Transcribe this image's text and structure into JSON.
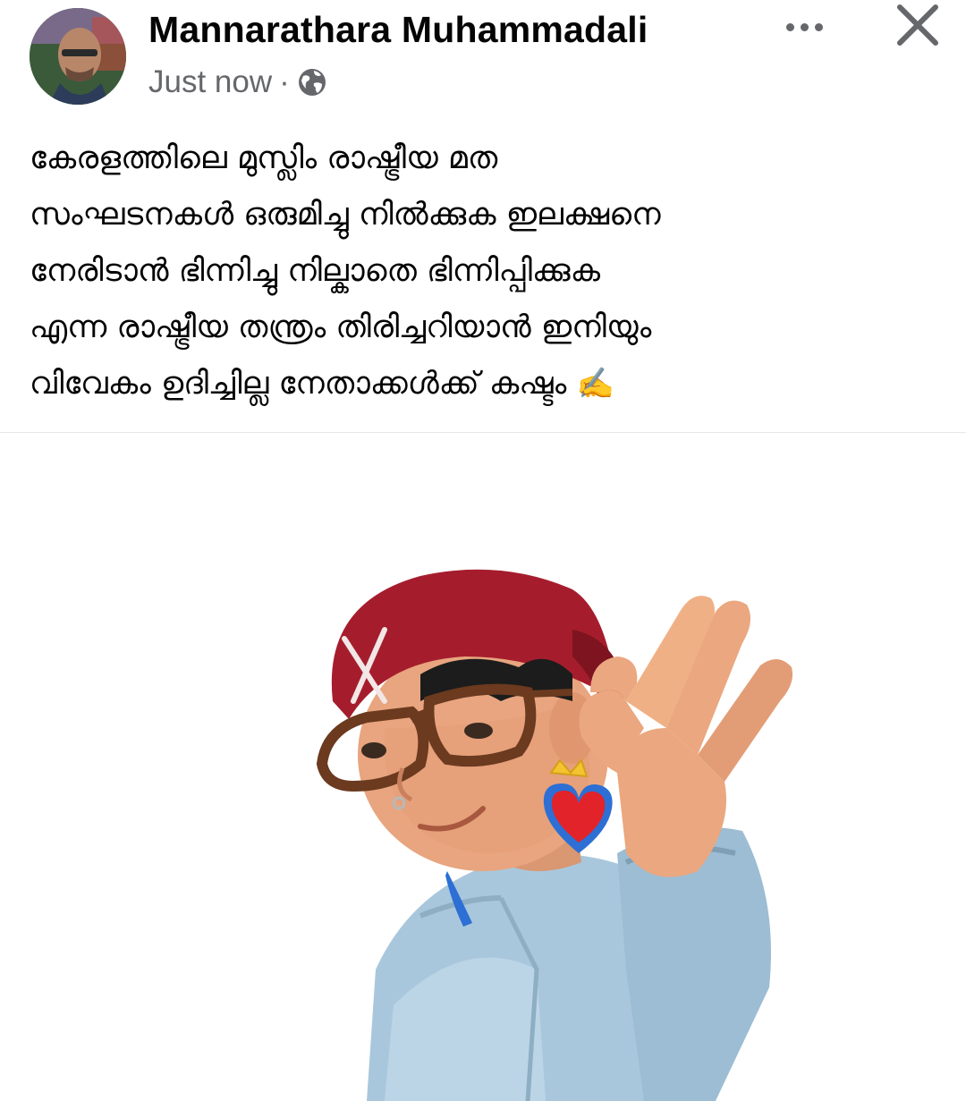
{
  "post": {
    "author": "Mannarathara Muhammadali",
    "timestamp": "Just now",
    "separator": "·",
    "privacy_icon": "globe-icon",
    "more_icon": "more-dots-icon",
    "close_icon": "close-icon",
    "text_lines": [
      "കേരളത്തിലെ മുസ്ലിം രാഷ്ട്രീയ മത",
      "സംഘടനകൾ ഒരുമിച്ചു നിൽക്കുക ഇലക്ഷനെ",
      "നേരിടാൻ ഭിന്നിച്ചു നില്കാതെ ഭിന്നിപ്പിക്കുക",
      "എന്ന രാഷ്ട്രീയ തന്ത്രം തിരിച്ചറിയാൻ ഇനിയും",
      "വിവേകം ഉദിച്ചില്ല നേതാക്കൾക്ക് കഷ്ടം"
    ],
    "text_emoji": "✍️",
    "image": {
      "subject": "3D cartoon avatar in red bandana and glasses making OK hand sign",
      "colors": {
        "bandana": "#a51d2d",
        "skin": "#e8a57f",
        "jacket": "#a9c7dc",
        "glasses": "#6b3a1f",
        "heart": "#e2232a"
      }
    }
  }
}
